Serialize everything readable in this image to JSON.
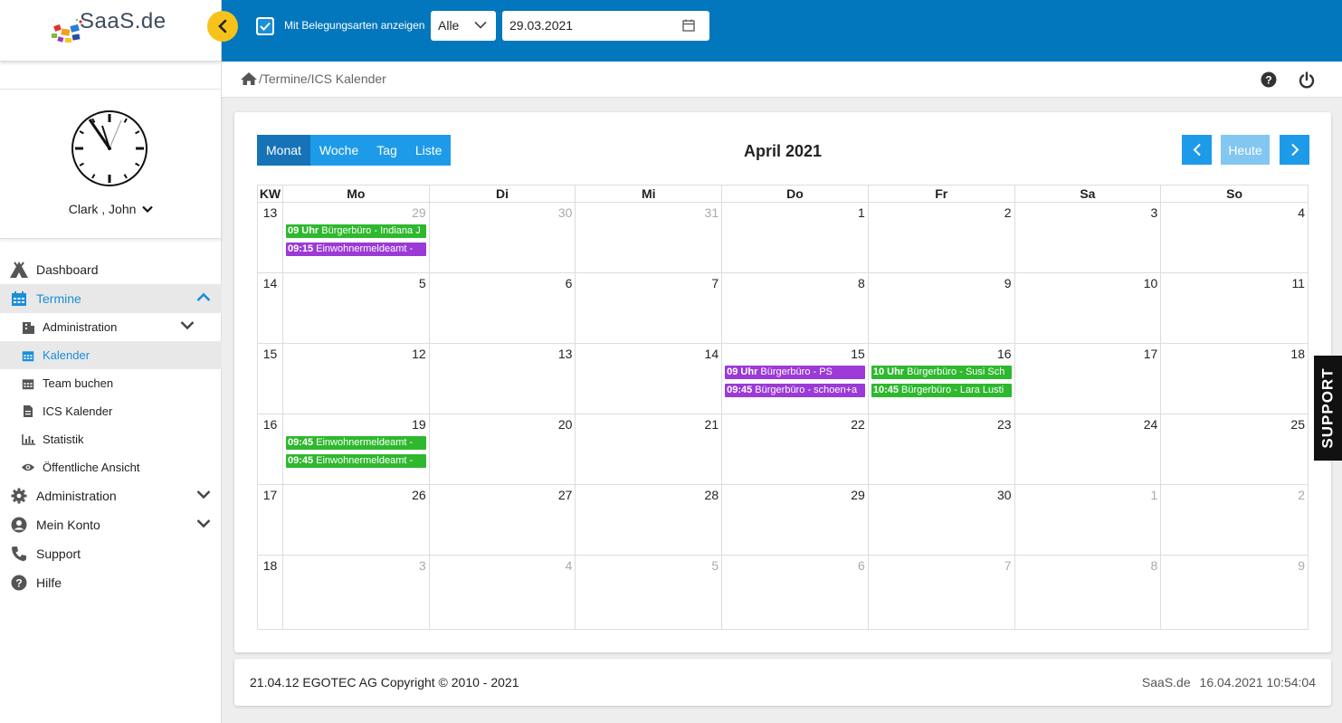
{
  "app": {
    "logo_text": "SaaS.de"
  },
  "user": {
    "name": "Clark , John"
  },
  "sidebar": {
    "items": [
      {
        "label": "Dashboard"
      },
      {
        "label": "Termine"
      },
      {
        "label": "Administration"
      },
      {
        "label": "Mein Konto"
      },
      {
        "label": "Support"
      },
      {
        "label": "Hilfe"
      }
    ],
    "sub_items": [
      {
        "label": "Administration"
      },
      {
        "label": "Kalender"
      },
      {
        "label": "Team buchen"
      },
      {
        "label": "ICS Kalender"
      },
      {
        "label": "Statistik"
      },
      {
        "label": "Öffentliche Ansicht"
      }
    ]
  },
  "toolbar": {
    "checkbox_label": "Mit Belegungsarten anzeigen",
    "checkbox_checked": true,
    "filter_value": "Alle",
    "date_value": "29.03.2021"
  },
  "breadcrumb": {
    "path": "/Termine/ICS Kalender"
  },
  "calendar": {
    "views": [
      "Monat",
      "Woche",
      "Tag",
      "Liste"
    ],
    "active_view": "Monat",
    "title": "April 2021",
    "today_label": "Heute",
    "headers": [
      "KW",
      "Mo",
      "Di",
      "Mi",
      "Do",
      "Fr",
      "Sa",
      "So"
    ],
    "weeks": [
      {
        "kw": "13",
        "days": [
          "29",
          "30",
          "31",
          "1",
          "2",
          "3",
          "4"
        ]
      },
      {
        "kw": "14",
        "days": [
          "5",
          "6",
          "7",
          "8",
          "9",
          "10",
          "11"
        ]
      },
      {
        "kw": "15",
        "days": [
          "12",
          "13",
          "14",
          "15",
          "16",
          "17",
          "18"
        ]
      },
      {
        "kw": "16",
        "days": [
          "19",
          "20",
          "21",
          "22",
          "23",
          "24",
          "25"
        ]
      },
      {
        "kw": "17",
        "days": [
          "26",
          "27",
          "28",
          "29",
          "30",
          "1",
          "2"
        ]
      },
      {
        "kw": "18",
        "days": [
          "3",
          "4",
          "5",
          "6",
          "7",
          "8",
          "9"
        ]
      }
    ],
    "events": {
      "w0_mo_1": {
        "time": "09 Uhr",
        "text": " Bürgerbüro - Indiana J",
        "color": "#2eb82e"
      },
      "w0_mo_2": {
        "time": "09:15",
        "text": " Einwohnermeldeamt - ",
        "color": "#9b3ad6"
      },
      "w2_do_1": {
        "time": "09 Uhr",
        "text": " Bürgerbüro - PS",
        "color": "#9b3ad6"
      },
      "w2_do_2": {
        "time": "09:45",
        "text": " Bürgerbüro - schoen+a",
        "color": "#9b3ad6"
      },
      "w2_fr_1": {
        "time": "10 Uhr",
        "text": " Bürgerbüro - Susi Sch",
        "color": "#2eb82e"
      },
      "w2_fr_2": {
        "time": "10:45",
        "text": " Bürgerbüro - Lara Lusti",
        "color": "#2eb82e"
      },
      "w3_mo_1": {
        "time": "09:45",
        "text": " Einwohnermeldeamt - ",
        "color": "#2eb82e"
      },
      "w3_mo_2": {
        "time": "09:45",
        "text": " Einwohnermeldeamt - ",
        "color": "#2eb82e"
      }
    }
  },
  "footer": {
    "left": "21.04.12 EGOTEC AG Copyright © 2010 - 2021",
    "brand": "SaaS.de",
    "timestamp": "16.04.2021 10:54:04"
  },
  "support_tab": "SUPPORT",
  "colors": {
    "primary": "#0277bd",
    "accent": "#1e9be8",
    "green": "#2eb82e",
    "purple": "#9b3ad6",
    "collapse": "#f7c21a"
  }
}
